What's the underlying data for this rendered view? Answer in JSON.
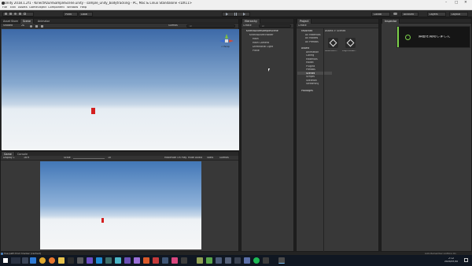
{
  "window": {
    "title": "Unity 2018.1.2f1 - KinectAzureSampleScene.unity - sample_unity_bodytracking - PC, Mac & Linux Standalone <DX11>"
  },
  "menu": [
    "File",
    "Edit",
    "Assets",
    "GameObject",
    "Component",
    "Window",
    "Help"
  ],
  "toolbar": {
    "pivot": "Pivot",
    "local": "Local",
    "collab": "Collab",
    "account": "Account",
    "layers": "Layers",
    "layout": "Layout"
  },
  "scene_view": {
    "tabs": [
      "Asset Store",
      "Scene",
      "Animator"
    ],
    "shaded": "Shaded",
    "mode_2d": "2D",
    "gizmos": "Gizmos",
    "search_placeholder": "All",
    "persp": "< Persp"
  },
  "game_view": {
    "tabs": [
      "Game",
      "Console"
    ],
    "display": "Display 1",
    "aspect": "16:9",
    "scale_label": "Scale",
    "scale_value": "1x",
    "maximize": "Maximize On Play",
    "mute": "Mute Audio",
    "stats": "Stats",
    "gizmos": "Gizmos"
  },
  "hierarchy": {
    "tab": "Hierarchy",
    "create": "Create",
    "search_placeholder": "All",
    "scene": "KinectAzureSampleScene",
    "items": [
      "KinectAzureTracker",
      "Main",
      "Main Camera",
      "Directional Light",
      "Plane"
    ]
  },
  "project": {
    "tab": "Project",
    "create": "Create",
    "favorites": "Favorites",
    "fav_items": [
      "All Materials",
      "All Models",
      "All Prefabs"
    ],
    "assets": "Assets",
    "asset_items": [
      "Animation",
      "Config",
      "Materials",
      "Model",
      "Plugins",
      "Prefabs",
      "Scenes",
      "Scripts",
      "Skeleton",
      "Streaming"
    ],
    "packages": "Packages",
    "breadcrumb": "Assets > Scenes",
    "files": [
      "KinectAzur...",
      "PlayInfoMas..."
    ]
  },
  "inspector": {
    "tab": "Inspector"
  },
  "toast": {
    "message": "録画を開始しました"
  },
  "status": {
    "message": "Use path from tracker (cached)"
  },
  "tray": {
    "text": "Auto Remember Lighting On",
    "time": "2:12",
    "date": "2020/07/20"
  }
}
